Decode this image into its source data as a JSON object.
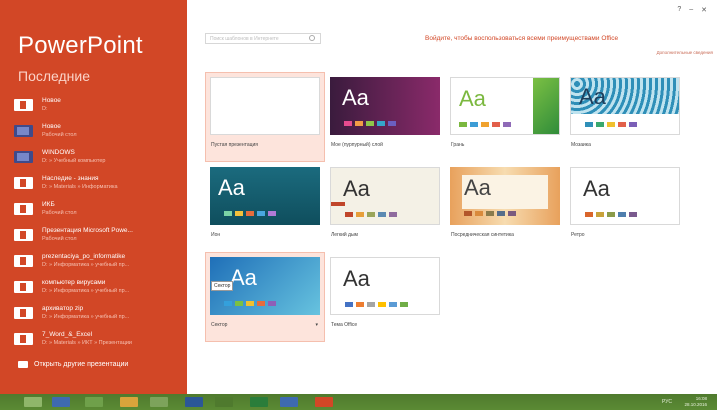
{
  "app": {
    "title": "PowerPoint",
    "recent_heading": "Последние"
  },
  "recent": [
    {
      "name": "Новое",
      "path": "D:",
      "icon": "pptx-file-icon"
    },
    {
      "name": "Новое",
      "path": "Рабочий стол",
      "icon": "image-file-icon"
    },
    {
      "name": "WINDOWS",
      "path": "D: » Учебный компьютер",
      "icon": "image-file-icon"
    },
    {
      "name": "Наследие - знания",
      "path": "D: » Materials » Информатика",
      "icon": "pptx-file-icon"
    },
    {
      "name": "ИКБ",
      "path": "Рабочий стол",
      "icon": "pptx-file-icon"
    },
    {
      "name": "Презентация Microsoft Powe...",
      "path": "Рабочий стол",
      "icon": "pptx-file-icon"
    },
    {
      "name": "prezentaciya_po_informatike",
      "path": "D: » Информатика » учебный пр...",
      "icon": "pptx-file-icon"
    },
    {
      "name": "компьютер вирусами",
      "path": "D: » Информатика » учебный пр...",
      "icon": "pptx-file-icon"
    },
    {
      "name": "архиватор zip",
      "path": "D: » Информатика » учебный пр...",
      "icon": "pptx-file-icon"
    },
    {
      "name": "7_Word_&_Excel",
      "path": "D: » Materials » ИКТ » Презентации",
      "icon": "pptx-file-icon"
    }
  ],
  "open_other_label": "Открыть другие презентации",
  "search_placeholder": "Поиск шаблонов в Интернете",
  "login_message": "Войдите, чтобы воспользоваться всеми преимуществами Office",
  "more_info": "Дополнительные сведения",
  "window_controls": {
    "help": "?",
    "minimize": "–",
    "close": "✕"
  },
  "templates": [
    {
      "label": "Пустая презентация",
      "selected": true
    },
    {
      "label": "Мое (пурпурный) слой"
    },
    {
      "label": "Грань"
    },
    {
      "label": "Мозаика"
    },
    {
      "label": "Ион"
    },
    {
      "label": "Легкий дым"
    },
    {
      "label": "Посредническая синтетика"
    },
    {
      "label": "Ретро"
    },
    {
      "label": "Сектор",
      "selected": true,
      "tooltip": "Сектор"
    },
    {
      "label": "Тема Office"
    }
  ],
  "thumb_text": "Aa",
  "taskbar": {
    "clock_time": "16:08",
    "clock_date": "28.10.2016",
    "tray_lang": "РУС"
  },
  "colors": {
    "accent": "#d24726",
    "taskbar": "#5b8a34"
  }
}
